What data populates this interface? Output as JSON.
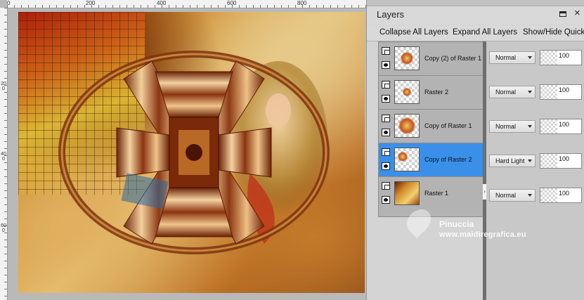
{
  "ruler": {
    "top": [
      "0",
      "200",
      "400",
      "600",
      "800"
    ],
    "left": [
      "200",
      "400",
      "600"
    ]
  },
  "panel": {
    "title": "Layers",
    "toolbar": {
      "collapse": "Collapse All Layers",
      "expand": "Expand All Layers",
      "showhide": "Show/Hide Quick"
    },
    "layers": [
      {
        "name": "Copy (2) of Raster 1",
        "blend": "Normal",
        "opacity": "100",
        "selected": false
      },
      {
        "name": "Raster 2",
        "blend": "Normal",
        "opacity": "100",
        "selected": false
      },
      {
        "name": "Copy of Raster 1",
        "blend": "Normal",
        "opacity": "100",
        "selected": false
      },
      {
        "name": "Copy of Raster 2",
        "blend": "Hard Light",
        "opacity": "100",
        "selected": true
      },
      {
        "name": "Raster 1",
        "blend": "Normal",
        "opacity": "100",
        "selected": false
      }
    ]
  },
  "watermark": {
    "line1": "Pinuccia",
    "line2": "www.maidiregrafica.eu"
  },
  "colors": {
    "selected": "#3a8fe8",
    "panel_bg": "#d4d4d4",
    "layers_bg": "#b3b3b3"
  }
}
